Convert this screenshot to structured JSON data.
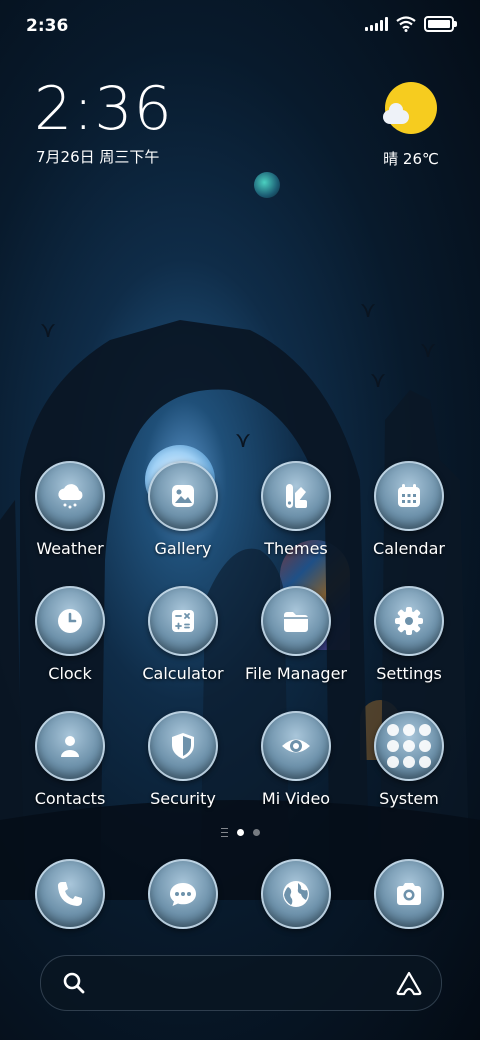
{
  "status_bar": {
    "time": "2:36"
  },
  "clock_widget": {
    "time": "2:36",
    "date": "7月26日 周三下午"
  },
  "weather_widget": {
    "text": "晴 26℃",
    "icon": "sun-cloud-icon"
  },
  "apps_row1": [
    {
      "label": "Weather",
      "icon": "weather-icon"
    },
    {
      "label": "Gallery",
      "icon": "gallery-icon"
    },
    {
      "label": "Themes",
      "icon": "themes-icon"
    },
    {
      "label": "Calendar",
      "icon": "calendar-icon"
    }
  ],
  "apps_row2": [
    {
      "label": "Clock",
      "icon": "clock-icon"
    },
    {
      "label": "Calculator",
      "icon": "calculator-icon"
    },
    {
      "label": "File Manager",
      "icon": "folder-icon"
    },
    {
      "label": "Settings",
      "icon": "gear-icon"
    }
  ],
  "apps_row3": [
    {
      "label": "Contacts",
      "icon": "person-icon"
    },
    {
      "label": "Security",
      "icon": "shield-icon"
    },
    {
      "label": "Mi Video",
      "icon": "eye-icon"
    },
    {
      "label": "System",
      "icon": "folder-grid-icon"
    }
  ],
  "dock": [
    {
      "icon": "phone-icon"
    },
    {
      "icon": "message-icon"
    },
    {
      "icon": "globe-icon"
    },
    {
      "icon": "camera-icon"
    }
  ],
  "page_indicator": {
    "current": 1,
    "total": 2
  },
  "search_bar": {
    "left_icon": "search-icon",
    "right_icon": "assistant-icon"
  },
  "colors": {
    "sun": "#f6cc1f",
    "icon_bubble": "#7c9db4",
    "background": "#081a2c"
  }
}
